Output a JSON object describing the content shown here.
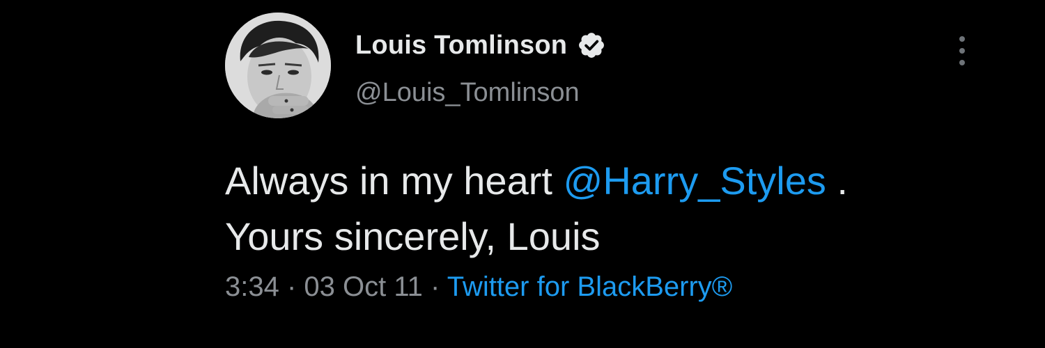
{
  "author": {
    "display_name": "Louis Tomlinson",
    "handle": "@Louis_Tomlinson",
    "verified_icon": "verified-badge-icon",
    "avatar_icon": "profile-photo"
  },
  "tweet": {
    "text_line1_prefix": "Always in my heart ",
    "mention": "@Harry_Styles",
    "text_line1_suffix": " .",
    "text_line2": "Yours sincerely, Louis"
  },
  "meta": {
    "time": "3:34",
    "separator1": " · ",
    "date": "03 Oct 11",
    "separator2": " · ",
    "source": "Twitter for BlackBerry®"
  },
  "menu_icon": "more-vertical-icon",
  "colors": {
    "background": "#000000",
    "text": "#e7e9ea",
    "secondary_text": "#8b8f94",
    "link": "#1d9bf0"
  }
}
